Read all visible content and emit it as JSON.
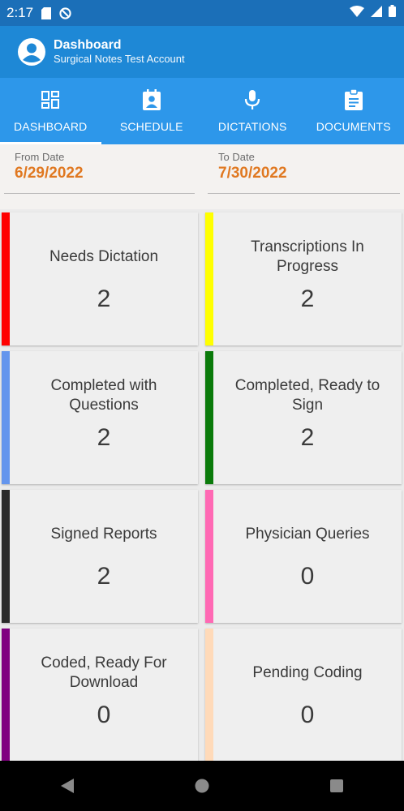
{
  "status_bar": {
    "time": "2:17"
  },
  "app_bar": {
    "title": "Dashboard",
    "subtitle": "Surgical Notes Test Account"
  },
  "tabs": [
    {
      "label": "DASHBOARD",
      "icon": "dashboard-icon",
      "active": true
    },
    {
      "label": "SCHEDULE",
      "icon": "calendar-person-icon",
      "active": false
    },
    {
      "label": "DICTATIONS",
      "icon": "microphone-icon",
      "active": false
    },
    {
      "label": "DOCUMENTS",
      "icon": "clipboard-icon",
      "active": false
    }
  ],
  "dates": {
    "from_label": "From Date",
    "from_value": "6/29/2022",
    "to_label": "To Date",
    "to_value": "7/30/2022"
  },
  "cards": [
    {
      "title": "Needs Dictation",
      "count": "2",
      "color": "#ff0000"
    },
    {
      "title": "Transcriptions In Progress",
      "count": "2",
      "color": "#ffff00"
    },
    {
      "title": "Completed with Questions",
      "count": "2",
      "color": "#6495ed"
    },
    {
      "title": "Completed, Ready to Sign",
      "count": "2",
      "color": "#0a7a0a"
    },
    {
      "title": "Signed Reports",
      "count": "2",
      "color": "#2a2a2a"
    },
    {
      "title": "Physician Queries",
      "count": "0",
      "color": "#ff69b4"
    },
    {
      "title": "Coded, Ready For Download",
      "count": "0",
      "color": "#800080"
    },
    {
      "title": "Pending Coding",
      "count": "0",
      "color": "#ffdab9"
    }
  ],
  "colors": {
    "status_bar": "#1b6fb8",
    "app_bar": "#1e88d6",
    "tab_bar": "#2d97ea",
    "date_value": "#e07820"
  }
}
